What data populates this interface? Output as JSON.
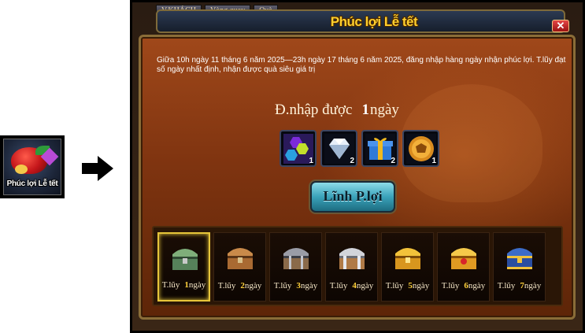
{
  "event_icon": {
    "label": "Phúc lợi Lễ tết"
  },
  "window": {
    "tabs": [
      "V.KHÁCH",
      "Vòng quay",
      "Quà"
    ],
    "title": "Phúc lợi Lễ tết",
    "close_label": "✕"
  },
  "panel": {
    "description": "Giữa 10h ngày 11 tháng 6 năm 2025—23h ngày 17 tháng 6 năm 2025, đăng nhập hàng ngày nhận phúc lợi. T.lũy đạt số ngày nhất định, nhận được quà siêu giá trị",
    "login_label": "Đ.nhập được",
    "login_days": "1",
    "login_unit": "ngày",
    "rewards": [
      {
        "icon": "gem-cluster-icon",
        "qty": "1"
      },
      {
        "icon": "diamond-icon",
        "qty": "2"
      },
      {
        "icon": "gift-box-icon",
        "qty": "2"
      },
      {
        "icon": "gold-coin-icon",
        "qty": "1"
      }
    ],
    "claim_label": "Lĩnh P.lợi",
    "days": [
      {
        "prefix": "T.lũy",
        "n": "1",
        "unit": "ngày",
        "active": true
      },
      {
        "prefix": "T.lũy",
        "n": "2",
        "unit": "ngày",
        "active": false
      },
      {
        "prefix": "T.lũy",
        "n": "3",
        "unit": "ngày",
        "active": false
      },
      {
        "prefix": "T.lũy",
        "n": "4",
        "unit": "ngày",
        "active": false
      },
      {
        "prefix": "T.lũy",
        "n": "5",
        "unit": "ngày",
        "active": false
      },
      {
        "prefix": "T.lũy",
        "n": "6",
        "unit": "ngày",
        "active": false
      },
      {
        "prefix": "T.lũy",
        "n": "7",
        "unit": "ngày",
        "active": false
      }
    ]
  },
  "colors": {
    "title_gold": "#ffcf2e",
    "panel_orange": "#a0481a",
    "active_day_border": "#e6c53a",
    "button_teal": "#3aa2ba"
  }
}
